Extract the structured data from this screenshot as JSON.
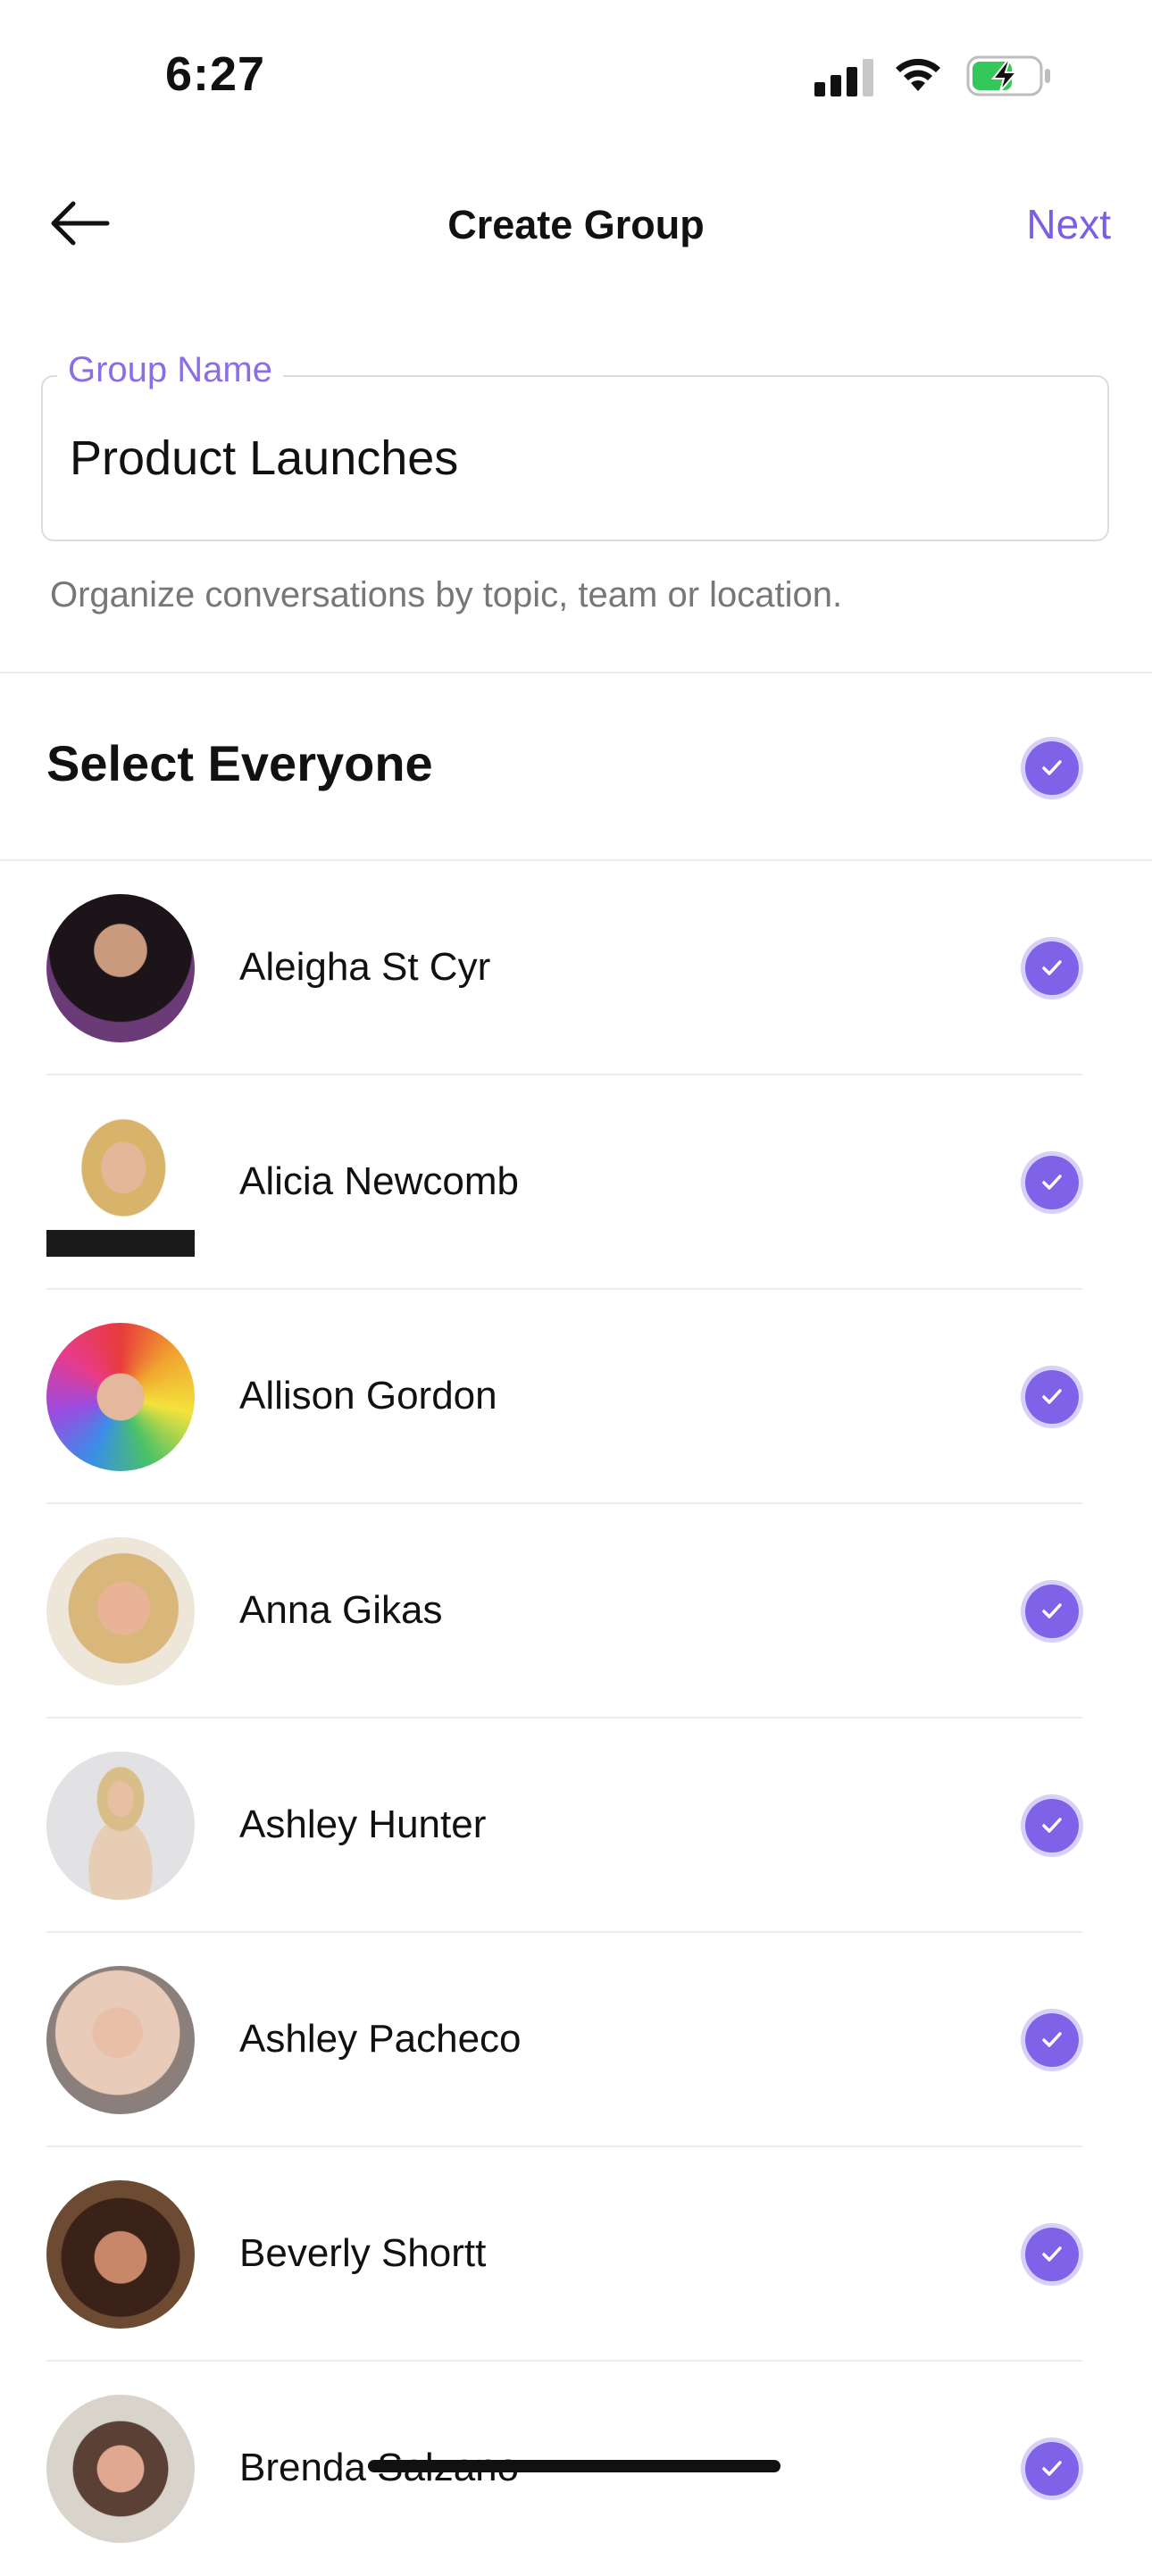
{
  "status_bar": {
    "time": "6:27",
    "signal_icon": "cellular-signal-icon",
    "wifi_icon": "wifi-icon",
    "battery_icon": "battery-charging-icon"
  },
  "nav": {
    "back_icon": "arrow-left-icon",
    "title": "Create Group",
    "next_label": "Next"
  },
  "group_name": {
    "label": "Group Name",
    "value": "Product Launches",
    "helper": "Organize conversations by topic, team or location."
  },
  "select_all": {
    "label": "Select Everyone",
    "checked": true
  },
  "members": [
    {
      "name": "Aleigha St Cyr",
      "checked": true
    },
    {
      "name": "Alicia Newcomb",
      "checked": true
    },
    {
      "name": "Allison Gordon",
      "checked": true
    },
    {
      "name": "Anna Gikas",
      "checked": true
    },
    {
      "name": "Ashley Hunter",
      "checked": true
    },
    {
      "name": "Ashley Pacheco",
      "checked": true
    },
    {
      "name": "Beverly Shortt",
      "checked": true
    },
    {
      "name": "Brenda Salzano",
      "checked": true
    }
  ],
  "colors": {
    "accent": "#7e62e8",
    "accent_text": "#7a5fe2",
    "divider": "#ececec"
  }
}
